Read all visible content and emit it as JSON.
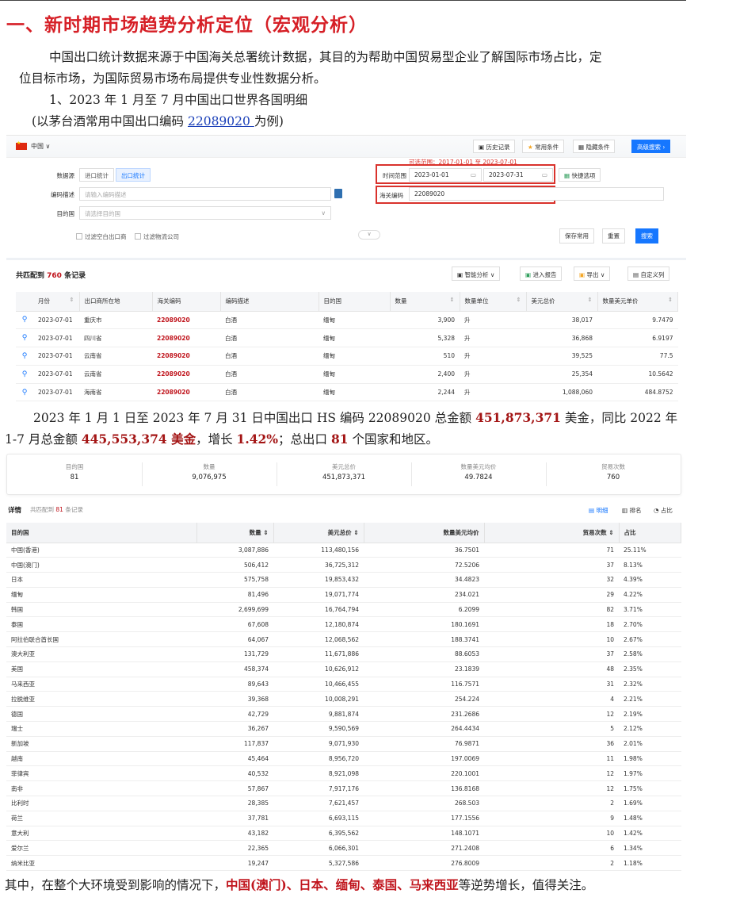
{
  "heading": "一、新时期市场趋势分析定位（宏观分析）",
  "intro_line1": "中国出口统计数据来源于中国海关总署统计数据，其目的为帮助中国贸易型企业了解国际市场占比，定",
  "intro_line2": "位目标市场，为国际贸易市场布局提供专业性数据分析。",
  "section1_title": "1、2023 年 1 月至 7 月中国出口世界各国明细",
  "example_prefix": "(以茅台酒常用中国出口编码 ",
  "example_code": "22089020 ",
  "example_suffix": "为例)",
  "search_panel": {
    "country": "中国 ∨",
    "toolbar": [
      "历史记录",
      "常用条件",
      "隐藏条件",
      "高级搜索 ›"
    ],
    "hint": "可选范围：2017-01-01 至 2023-07-01",
    "datasource_label": "数据源",
    "datasource_options": [
      "进口统计",
      "出口统计"
    ],
    "code_desc_label": "编码描述",
    "code_desc_placeholder": "请输入编码描述",
    "dest_label": "目的国",
    "dest_placeholder": "请选择目的国",
    "time_label": "时间范围",
    "date_from": "2023-01-01",
    "date_to": "2023-07-31",
    "quick_option": "快捷选项",
    "hs_label": "海关编码",
    "hs_value": "22089020",
    "chk1": "过滤空白出口商",
    "chk2": "过滤物流公司",
    "btn_save": "保存常用",
    "btn_reset": "重置",
    "btn_search": "搜索"
  },
  "results": {
    "prefix": "共匹配到 ",
    "count": "760",
    "suffix": " 条记录",
    "buttons": [
      "智能分析",
      "进入报告",
      "导出",
      "自定义列"
    ],
    "columns": [
      "月份",
      "出口商所在地",
      "海关编码",
      "编码描述",
      "目的国",
      "数量",
      "数量单位",
      "美元总价",
      "数量美元单价"
    ],
    "rows": [
      [
        "2023-07-01",
        "重庆市",
        "22089020",
        "白酒",
        "缅甸",
        "3,900",
        "升",
        "38,017",
        "9.7479"
      ],
      [
        "2023-07-01",
        "四川省",
        "22089020",
        "白酒",
        "缅甸",
        "5,328",
        "升",
        "36,868",
        "6.9197"
      ],
      [
        "2023-07-01",
        "云南省",
        "22089020",
        "白酒",
        "缅甸",
        "510",
        "升",
        "39,525",
        "77.5"
      ],
      [
        "2023-07-01",
        "云南省",
        "22089020",
        "白酒",
        "缅甸",
        "2,400",
        "升",
        "25,354",
        "10.5642"
      ],
      [
        "2023-07-01",
        "海南省",
        "22089020",
        "白酒",
        "缅甸",
        "2,244",
        "升",
        "1,088,060",
        "484.8752"
      ]
    ]
  },
  "summary_text": {
    "p1": "2023 年 1 月 1 日至 2023 年 7 月 31 日中国出口 HS 编码 22089020 总金额 ",
    "amount": "451,873,371",
    "p2": " 美金，同比 2022 年",
    "p3": "1-7 月总金额 ",
    "amount2": "445,553,374 美金",
    "p4": "，增长 ",
    "growth": "1.42%",
    "p5": "；总出口 ",
    "countries": "81",
    "p6": " 个国家和地区。"
  },
  "summary_cards": [
    {
      "k": "目的国",
      "v": "81"
    },
    {
      "k": "数量",
      "v": "9,076,975"
    },
    {
      "k": "美元总价",
      "v": "451,873,371"
    },
    {
      "k": "数量美元均价",
      "v": "49.7824"
    },
    {
      "k": "贸易次数",
      "v": "760"
    }
  ],
  "detail": {
    "label": "详情",
    "count_prefix": "共匹配到 ",
    "count": "81",
    "count_suffix": " 条记录",
    "views": [
      "▤ 明细",
      "▥ 排名",
      "◔ 占比"
    ],
    "columns": [
      "目的国",
      "数量 ⇕",
      "美元总价 ⇕",
      "数量美元均价",
      "贸易次数 ⇕",
      "占比"
    ],
    "rows": [
      [
        "中国(香港)",
        "3,087,886",
        "113,480,156",
        "36.7501",
        "71",
        "25.11%"
      ],
      [
        "中国(澳门)",
        "506,412",
        "36,725,312",
        "72.5206",
        "37",
        "8.13%"
      ],
      [
        "日本",
        "575,758",
        "19,853,432",
        "34.4823",
        "32",
        "4.39%"
      ],
      [
        "缅甸",
        "81,496",
        "19,071,774",
        "234.021",
        "29",
        "4.22%"
      ],
      [
        "韩国",
        "2,699,699",
        "16,764,794",
        "6.2099",
        "82",
        "3.71%"
      ],
      [
        "泰国",
        "67,608",
        "12,180,874",
        "180.1691",
        "18",
        "2.70%"
      ],
      [
        "阿拉伯联合酋长国",
        "64,067",
        "12,068,562",
        "188.3741",
        "10",
        "2.67%"
      ],
      [
        "澳大利亚",
        "131,729",
        "11,671,886",
        "88.6053",
        "37",
        "2.58%"
      ],
      [
        "美国",
        "458,374",
        "10,626,912",
        "23.1839",
        "48",
        "2.35%"
      ],
      [
        "马来西亚",
        "89,643",
        "10,466,455",
        "116.7571",
        "31",
        "2.32%"
      ],
      [
        "拉脱维亚",
        "39,368",
        "10,008,291",
        "254.224",
        "4",
        "2.21%"
      ],
      [
        "德国",
        "42,729",
        "9,881,874",
        "231.2686",
        "12",
        "2.19%"
      ],
      [
        "瑞士",
        "36,267",
        "9,590,569",
        "264.4434",
        "5",
        "2.12%"
      ],
      [
        "新加坡",
        "117,837",
        "9,071,930",
        "76.9871",
        "36",
        "2.01%"
      ],
      [
        "越南",
        "45,464",
        "8,956,720",
        "197.0069",
        "11",
        "1.98%"
      ],
      [
        "菲律宾",
        "40,532",
        "8,921,098",
        "220.1001",
        "12",
        "1.97%"
      ],
      [
        "南非",
        "57,867",
        "7,917,176",
        "136.8168",
        "12",
        "1.75%"
      ],
      [
        "比利时",
        "28,385",
        "7,621,457",
        "268.503",
        "2",
        "1.69%"
      ],
      [
        "荷兰",
        "37,781",
        "6,693,115",
        "177.1556",
        "9",
        "1.48%"
      ],
      [
        "意大利",
        "43,182",
        "6,395,562",
        "148.1071",
        "10",
        "1.42%"
      ],
      [
        "爱尔兰",
        "22,365",
        "6,066,301",
        "271.2408",
        "6",
        "1.34%"
      ],
      [
        "纳米比亚",
        "19,247",
        "5,327,586",
        "276.8009",
        "2",
        "1.18%"
      ]
    ]
  },
  "closing": {
    "p1": "其中，在整个大环境受到影响的情况下，",
    "highlight": "中国(澳门)、日本、缅甸、泰国、马来西亚",
    "p2": "等逆势增长，值得关注。"
  }
}
